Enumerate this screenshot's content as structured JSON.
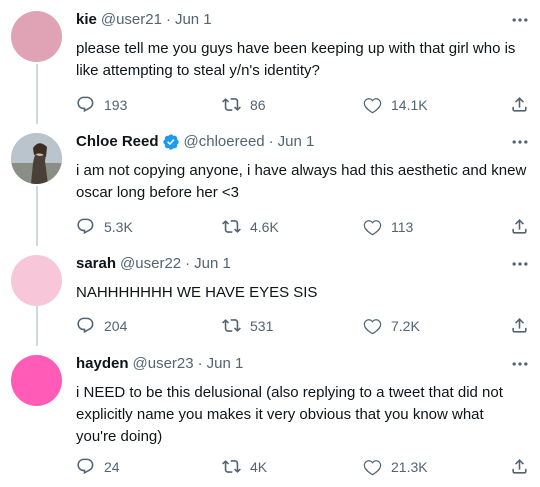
{
  "colors": {
    "avatar_kie": "#e0a3b6",
    "avatar_sarah": "#f7c6d9",
    "avatar_hayden": "#ff5bb7",
    "verified": "#1d9bf0",
    "secondary_text": "#536471",
    "thread_line": "#cfd9de"
  },
  "tweets": [
    {
      "name": "kie",
      "handle": "@user21",
      "date": "Jun 1",
      "text": "please tell me you guys have been keeping up with that girl who is like attempting to steal y/n's identity?",
      "replies": "193",
      "retweets": "86",
      "likes": "14.1K"
    },
    {
      "name": "Chloe Reed",
      "handle": "@chloereed",
      "date": "Jun 1",
      "verified": true,
      "text": "i am not copying anyone, i have always had this aesthetic and knew oscar long before her <3",
      "replies": "5.3K",
      "retweets": "4.6K",
      "likes": "113"
    },
    {
      "name": "sarah",
      "handle": "@user22",
      "date": "Jun 1",
      "text": "NAHHHHHHH WE HAVE EYES SIS",
      "replies": "204",
      "retweets": "531",
      "likes": "7.2K"
    },
    {
      "name": "hayden",
      "handle": "@user23",
      "date": "Jun 1",
      "text": "i NEED to be this delusional (also replying to a tweet that did not explicitly name you makes it very obvious that you know what you're doing)",
      "replies": "24",
      "retweets": "4K",
      "likes": "21.3K"
    }
  ],
  "separator": "·"
}
